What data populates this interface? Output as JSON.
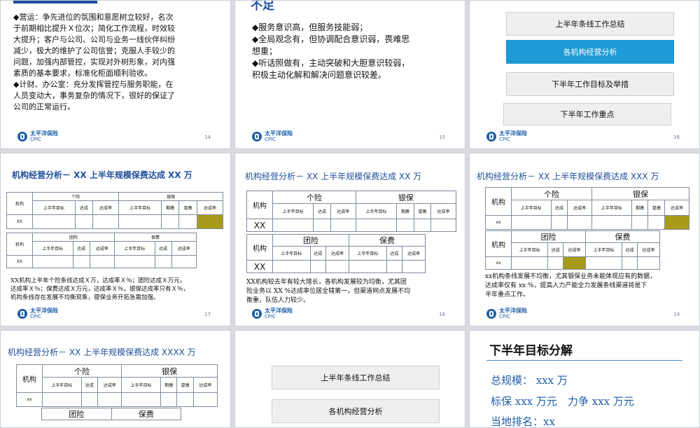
{
  "brand": {
    "cn": "太平洋保险",
    "en": "CPIC"
  },
  "slide14": {
    "page": "14",
    "lines": [
      "◆营运：争先进位的氛围和意愿树立较好，名次",
      "于前期相比提升Ｘ位次；简化工作流程，时效较",
      "大提升；客户与公司、公司与业务一线伙伴纠纷",
      "减少，极大的维护了公司信誉；克服人手较少的",
      "问题，加强内部管控，实现对外树形象，对内强",
      "素质的基本要求，标准化柜面顺利验收。",
      "◆计财、办公室：充分发挥管控与服务职能，在",
      "人员变动大，事务复杂的情况下，很好的保证了",
      "公司的正常运行。"
    ]
  },
  "slide15": {
    "page": "15",
    "heading": "不足",
    "lines": [
      "◆服务意识高，但服务技能弱；",
      "◆全局观念有，但协调配合意识弱，畏难思",
      "想重；",
      "◆听话照做有，主动突破和大胆意识较弱，",
      "积极主动化解和解决问题意识较差。"
    ]
  },
  "slide16": {
    "page": "16",
    "items": [
      "上半年条线工作总结",
      "各机构经营分析",
      "下半年工作目标及举措",
      "下半年工作重点"
    ]
  },
  "slide17": {
    "page": "17",
    "title": "机构经营分析－ XX 上半年规模保费达成 XX 万",
    "t1": {
      "c0": "机构",
      "g1": "个险",
      "g2": "银保",
      "h1": "上半年目标",
      "h2": "达成",
      "h3": "达成率",
      "h4": "上半年目标",
      "h5": "期缴",
      "h6": "趸缴",
      "h7": "达成率",
      "row": "XX"
    },
    "t2": {
      "c0": "机构",
      "g1": "团险",
      "g2": "保费",
      "h1": "上半年目标",
      "h2": "达成",
      "h3": "达成率",
      "h4": "上半年目标",
      "h5": "达成",
      "h6": "达成率",
      "row": "XX"
    },
    "lines": [
      "XX机构上半年个险条线达成Ｘ万，达成率Ｘ％；团险达成Ｘ万元，",
      "达成率Ｘ％；保费达成Ｘ万元，达成率Ｘ％，银保达成率只有Ｘ％，",
      "机构条线存在发展不均衡现象，银保业务开拓急需加强。"
    ]
  },
  "slide18": {
    "page": "18",
    "title": "机构经营分析－ XX 上半年规模保费达成 XX 万",
    "t1": {
      "c0": "机构",
      "g1": "个险",
      "g2": "银保",
      "h1": "上半年目标",
      "h2": "达成",
      "h3": "达成率",
      "h4": "上半年目标",
      "h5": "期缴",
      "h6": "趸缴",
      "h7": "达成率",
      "row": "XX"
    },
    "t2": {
      "c0": "机构",
      "g1": "团险",
      "g2": "保费",
      "h1": "上半年目标",
      "h2": "达成",
      "h3": "达成率",
      "h4": "上半年目标",
      "h5": "达成",
      "h6": "达成率",
      "row": "XX"
    },
    "lines": [
      "XX机构较去年有较大增长，各机构发展较为均衡，尤其团",
      "险业务以 XX %达成率位居全辖第一，但渠道网点发展不均",
      "衡重，队伍人力较少。"
    ]
  },
  "slide19": {
    "page": "19",
    "title": "机构经营分析－ XX 上半年规模保费达成 XXX 万",
    "t1": {
      "c0": "机构",
      "g1": "个险",
      "g2": "银保",
      "h1": "上半年目标",
      "h2": "达成",
      "h3": "达成率",
      "h4": "上半年目标",
      "h5": "期缴",
      "h6": "趸缴",
      "h7": "达成率",
      "row": "xx"
    },
    "t2": {
      "c0": "机构",
      "g1": "团险",
      "g2": "保费",
      "h1": "上半年目标",
      "h2": "达成",
      "h3": "达成率",
      "h4": "上半年目标",
      "h5": "达成",
      "h6": "达成率",
      "row": "xx"
    },
    "lines": [
      "xx机构条线发展不均衡，尤其银保业务未能体现应有的数据，",
      "达成率仅有 xx %，提高人力产能全力发展条线渠道将是下",
      "半年重点工作。"
    ]
  },
  "slide20": {
    "title": "机构经营分析－ XX 上半年规模保费达成 XXXX 万",
    "t1": {
      "c0": "机构",
      "g1": "个险",
      "g2": "银保",
      "h1": "上半年目标",
      "h2": "达成",
      "h3": "达成率",
      "h4": "上半年目标",
      "h5": "期缴",
      "h6": "趸缴",
      "h7": "达成率",
      "row": "xx"
    },
    "t2": {
      "g1": "团险",
      "g2": "保费"
    }
  },
  "slide21": {
    "items": [
      "上半年条线工作总结",
      "各机构经营分析"
    ]
  },
  "slide22": {
    "title": "下半年目标分解",
    "l1": "总规模： xxx 万",
    "l2": "标保 xxx 万元　力争 xxx 万元",
    "l3": "当地排名：xx"
  }
}
